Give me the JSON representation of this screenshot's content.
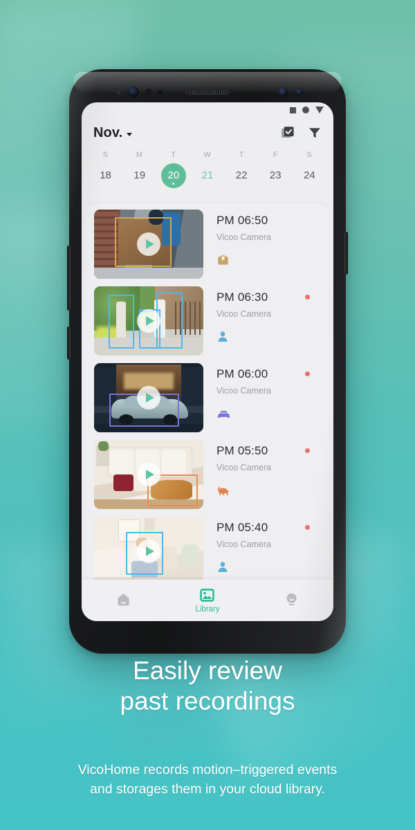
{
  "marketing": {
    "headline_line1": "Easily review",
    "headline_line2": "past recordings",
    "subcopy_line1": "VicoHome records motion–triggered events",
    "subcopy_line2": "and storages them in your cloud library."
  },
  "statusbar": {
    "icons": [
      "square-icon",
      "circle-icon",
      "triangle-icon"
    ]
  },
  "header": {
    "month": "Nov.",
    "dropdown_icon": "chevron-down-icon",
    "select_icon": "multi-select-checkbox-icon",
    "filter_icon": "filter-funnel-icon"
  },
  "calendar": {
    "days": [
      {
        "dow": "S",
        "num": "18",
        "state": "past"
      },
      {
        "dow": "M",
        "num": "19",
        "state": "past"
      },
      {
        "dow": "T",
        "num": "20",
        "state": "selected"
      },
      {
        "dow": "W",
        "num": "21",
        "state": "future"
      },
      {
        "dow": "T",
        "num": "22",
        "state": "past"
      },
      {
        "dow": "F",
        "num": "23",
        "state": "past"
      },
      {
        "dow": "S",
        "num": "24",
        "state": "past"
      }
    ]
  },
  "events": [
    {
      "time": "PM 06:50",
      "camera": "Vicoo Camera",
      "tag_icon": "package-icon",
      "tag_color": "#c8a166",
      "unread": false,
      "scene": "delivery"
    },
    {
      "time": "PM 06:30",
      "camera": "Vicoo Camera",
      "tag_icon": "person-icon",
      "tag_color": "#5bafdb",
      "unread": true,
      "scene": "people-walking"
    },
    {
      "time": "PM 06:00",
      "camera": "Vicoo Camera",
      "tag_icon": "car-icon",
      "tag_color": "#7a73d8",
      "unread": true,
      "scene": "car-night"
    },
    {
      "time": "PM 05:50",
      "camera": "Vicoo Camera",
      "tag_icon": "dog-icon",
      "tag_color": "#e2834f",
      "unread": true,
      "scene": "dog-livingroom"
    },
    {
      "time": "PM 05:40",
      "camera": "Vicoo Camera",
      "tag_icon": "person-icon",
      "tag_color": "#5bafdb",
      "unread": true,
      "scene": "person-sofa"
    }
  ],
  "nav": {
    "items": [
      {
        "label": "",
        "icon": "home-icon",
        "active": false
      },
      {
        "label": "Library",
        "icon": "library-image-icon",
        "active": true
      },
      {
        "label": "",
        "icon": "profile-icon",
        "active": false
      }
    ]
  },
  "colors": {
    "accent_green": "#5ebd9a",
    "nav_active": "#2bbd95",
    "unread_red": "#e8706e",
    "bg_top": "#6fc0a8",
    "bg_bottom": "#45c3c6"
  }
}
